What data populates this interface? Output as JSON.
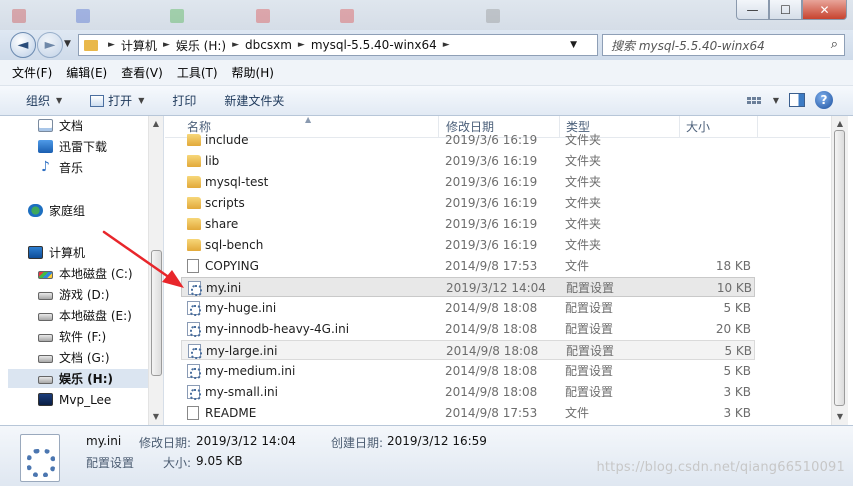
{
  "window": {
    "minimize_glyph": "—",
    "maximize_glyph": "☐",
    "close_glyph": "✕"
  },
  "address": {
    "breadcrumb": [
      "计算机",
      "娱乐 (H:)",
      "dbcsxm",
      "mysql-5.5.40-winx64"
    ],
    "search_placeholder": "搜索 mysql-5.5.40-winx64",
    "back_glyph": "◄",
    "forward_glyph": "►"
  },
  "menu": [
    "文件(F)",
    "编辑(E)",
    "查看(V)",
    "工具(T)",
    "帮助(H)"
  ],
  "commands": {
    "organize": "组织",
    "open": "打开",
    "print": "打印",
    "new_folder": "新建文件夹"
  },
  "nav": {
    "items": [
      {
        "label": "文档",
        "icon": "document-icon",
        "kind": "doc"
      },
      {
        "label": "迅雷下载",
        "icon": "download-icon",
        "kind": "dl"
      },
      {
        "label": "音乐",
        "icon": "music-icon",
        "kind": "music"
      },
      {
        "label": "家庭组",
        "icon": "homegroup-icon",
        "kind": "home"
      },
      {
        "label": "计算机",
        "icon": "computer-icon",
        "kind": "pc"
      },
      {
        "label": "本地磁盘 (C:)",
        "icon": "drive-c-icon",
        "kind": "drive drive-c"
      },
      {
        "label": "游戏 (D:)",
        "icon": "drive-icon",
        "kind": "drive"
      },
      {
        "label": "本地磁盘 (E:)",
        "icon": "drive-icon",
        "kind": "drive"
      },
      {
        "label": "软件 (F:)",
        "icon": "drive-icon",
        "kind": "drive"
      },
      {
        "label": "文档 (G:)",
        "icon": "drive-icon",
        "kind": "drive"
      },
      {
        "label": "娱乐 (H:)",
        "icon": "drive-icon",
        "kind": "drive",
        "selected": true
      },
      {
        "label": "Mvp_Lee",
        "icon": "user-folder-icon",
        "kind": "lee"
      }
    ]
  },
  "columns": {
    "name": "名称",
    "date": "修改日期",
    "type": "类型",
    "size": "大小"
  },
  "files": [
    {
      "name": "include",
      "date": "2019/3/6 16:19",
      "type": "文件夹",
      "size": "",
      "kind": "folder"
    },
    {
      "name": "lib",
      "date": "2019/3/6 16:19",
      "type": "文件夹",
      "size": "",
      "kind": "folder"
    },
    {
      "name": "mysql-test",
      "date": "2019/3/6 16:19",
      "type": "文件夹",
      "size": "",
      "kind": "folder"
    },
    {
      "name": "scripts",
      "date": "2019/3/6 16:19",
      "type": "文件夹",
      "size": "",
      "kind": "folder"
    },
    {
      "name": "share",
      "date": "2019/3/6 16:19",
      "type": "文件夹",
      "size": "",
      "kind": "folder"
    },
    {
      "name": "sql-bench",
      "date": "2019/3/6 16:19",
      "type": "文件夹",
      "size": "",
      "kind": "folder"
    },
    {
      "name": "COPYING",
      "date": "2014/9/8 17:53",
      "type": "文件",
      "size": "18 KB",
      "kind": "file"
    },
    {
      "name": "my.ini",
      "date": "2019/3/12 14:04",
      "type": "配置设置",
      "size": "10 KB",
      "kind": "ini",
      "highlight": "selected"
    },
    {
      "name": "my-huge.ini",
      "date": "2014/9/8 18:08",
      "type": "配置设置",
      "size": "5 KB",
      "kind": "ini"
    },
    {
      "name": "my-innodb-heavy-4G.ini",
      "date": "2014/9/8 18:08",
      "type": "配置设置",
      "size": "20 KB",
      "kind": "ini"
    },
    {
      "name": "my-large.ini",
      "date": "2014/9/8 18:08",
      "type": "配置设置",
      "size": "5 KB",
      "kind": "ini",
      "highlight": "hover"
    },
    {
      "name": "my-medium.ini",
      "date": "2014/9/8 18:08",
      "type": "配置设置",
      "size": "5 KB",
      "kind": "ini"
    },
    {
      "name": "my-small.ini",
      "date": "2014/9/8 18:08",
      "type": "配置设置",
      "size": "3 KB",
      "kind": "ini"
    },
    {
      "name": "README",
      "date": "2014/9/8 17:53",
      "type": "文件",
      "size": "3 KB",
      "kind": "file"
    }
  ],
  "details": {
    "filename": "my.ini",
    "filetype": "配置设置",
    "modified_label": "修改日期:",
    "modified_value": "2019/3/12 14:04",
    "created_label": "创建日期:",
    "created_value": "2019/3/12 16:59",
    "size_label": "大小:",
    "size_value": "9.05 KB"
  },
  "watermark": "https://blog.csdn.net/qiang66510091",
  "colors": {
    "annotation_arrow": "#e8262b",
    "selection": "#dbe5f1"
  }
}
